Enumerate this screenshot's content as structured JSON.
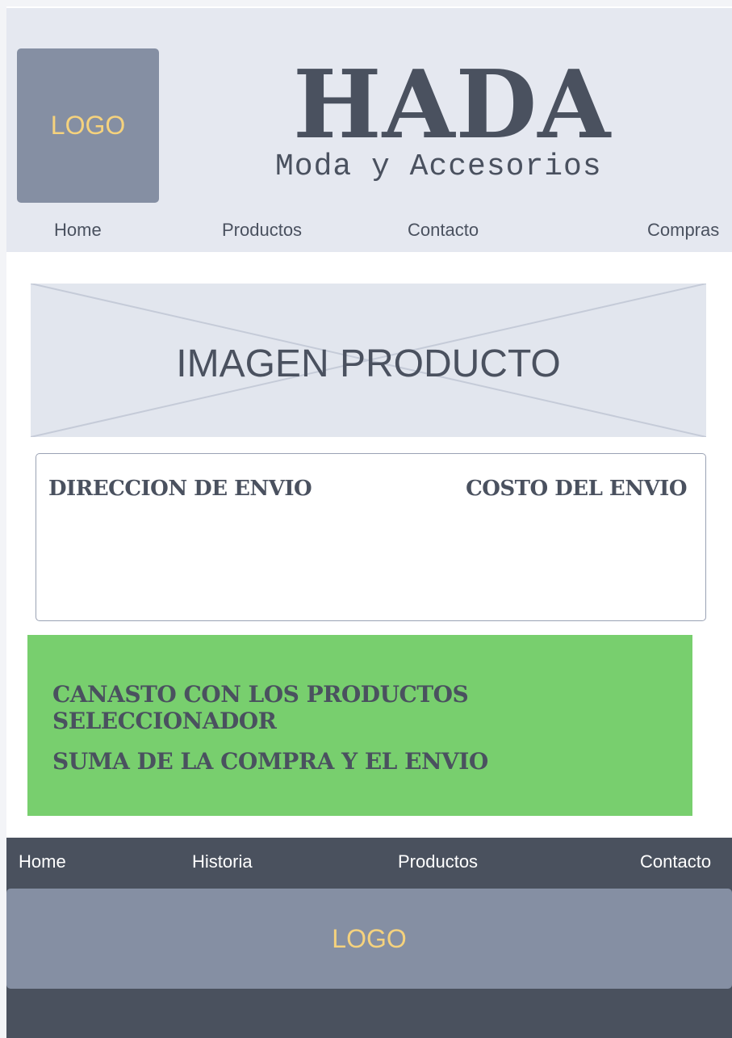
{
  "header": {
    "logo_text": "LOGO",
    "brand": "HADA",
    "tagline": "Moda y Accesorios",
    "nav": [
      "Home",
      "Productos",
      "Contacto",
      "Compras"
    ]
  },
  "product": {
    "image_label": "IMAGEN PRODUCTO"
  },
  "shipping": {
    "address_label": "DIRECCION DE ENVIO",
    "cost_label": "COSTO DEL ENVIO"
  },
  "cart": {
    "line1": "CANASTO CON LOS PRODUCTOS SELECCIONADOR",
    "line2": "SUMA DE LA COMPRA Y EL ENVIO"
  },
  "footer": {
    "nav": [
      "Home",
      "Historia",
      "Productos",
      "Contacto"
    ],
    "logo_text": "LOGO"
  },
  "colors": {
    "header_bg": "#e5e8f0",
    "logo_bg": "#858fa3",
    "logo_text": "#f5d27d",
    "text_dark": "#4a515f",
    "cart_bg": "#78cf6e",
    "footer_bg": "#4a515e"
  }
}
